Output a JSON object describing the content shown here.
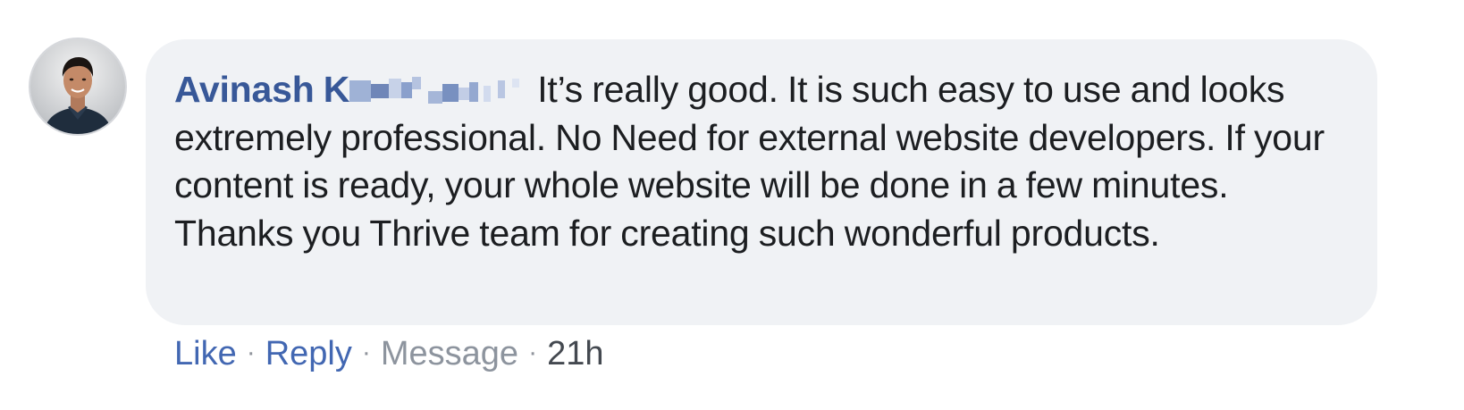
{
  "comment": {
    "author_visible": "Avinash K",
    "author_redacted": true,
    "text": "It’s really good. It is such easy to use and looks extremely professional. No Need for external website developers. If your content is ready, your whole website will be done in a few minutes. Thanks you Thrive team for creating such wonderful products."
  },
  "actions": {
    "like": "Like",
    "separator": "·",
    "reply": "Reply",
    "message": "Message",
    "time": "21h"
  },
  "colors": {
    "author": "#385898",
    "link": "#4267b2",
    "bubble": "#f0f2f5",
    "text": "#1c1e21",
    "muted": "#8d949e"
  }
}
